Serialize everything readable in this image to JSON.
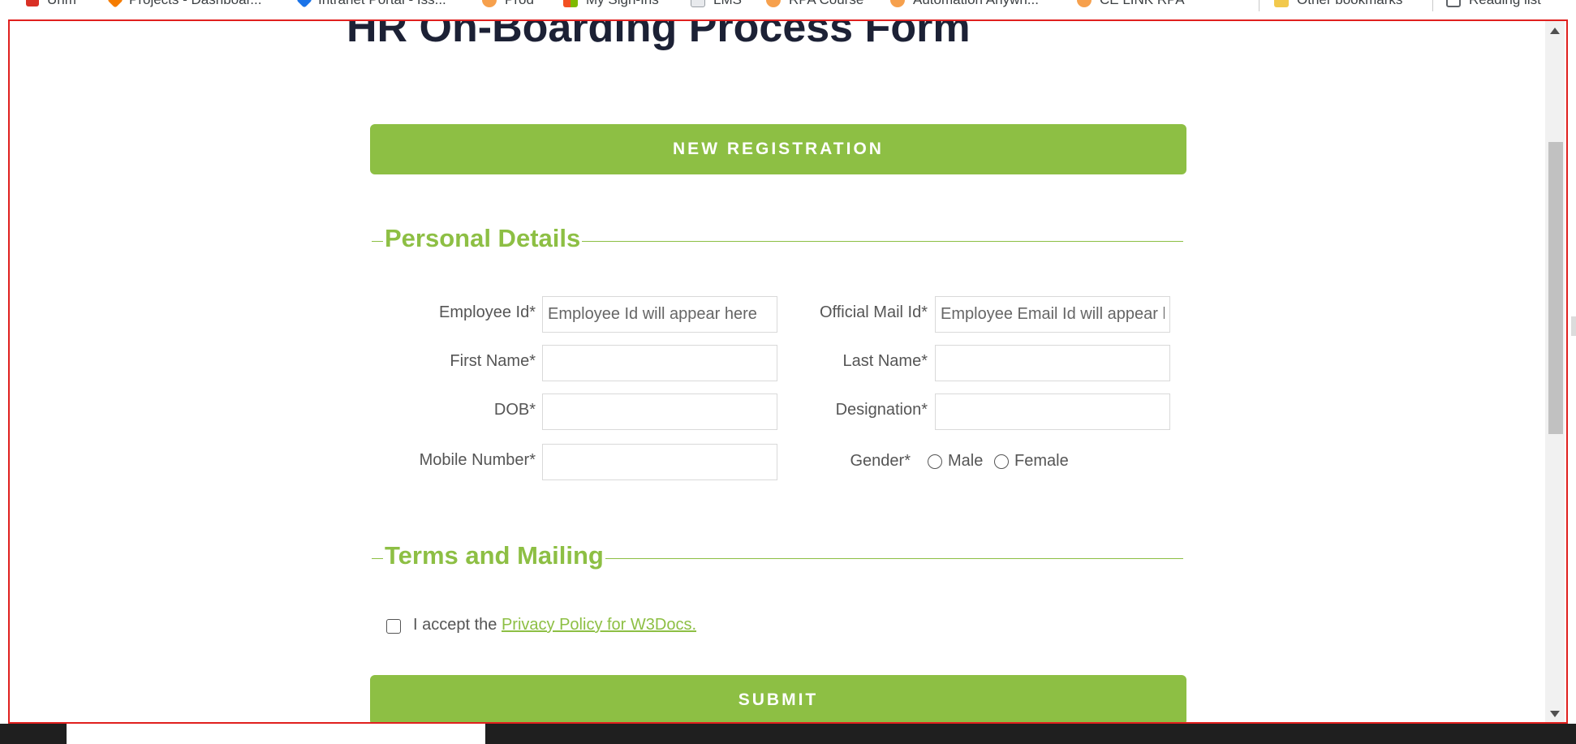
{
  "bookmarks": [
    {
      "label": "Unm",
      "color": "#d93025"
    },
    {
      "label": "Projects - Dashboar...",
      "color": "#f57c00"
    },
    {
      "label": "Intranet Portal - Iss...",
      "color": "#1a73e8"
    },
    {
      "label": "Prod",
      "color": "#f6a04d"
    },
    {
      "label": "My Sign-Ins",
      "color": "#00a4ef"
    },
    {
      "label": "LMS",
      "color": "#5f6368"
    },
    {
      "label": "RPA Course",
      "color": "#f6a04d"
    },
    {
      "label": "Automation Anywh...",
      "color": "#f6a04d"
    },
    {
      "label": "CE LINK RPA",
      "color": "#f6a04d"
    },
    {
      "label": "Other bookmarks",
      "color": "#f2c94c"
    },
    {
      "label": "Reading list",
      "color": "#5f6368"
    }
  ],
  "page": {
    "title": "HR On-Boarding Process Form",
    "new_registration_label": "NEW REGISTRATION",
    "submit_label": "SUBMIT"
  },
  "personal": {
    "legend": "Personal Details",
    "employee_id_label": "Employee Id*",
    "employee_id_placeholder": "Employee Id will appear here",
    "official_mail_label": "Official Mail Id*",
    "official_mail_placeholder": "Employee Email Id will appear here",
    "first_name_label": "First Name*",
    "last_name_label": "Last Name*",
    "dob_label": "DOB*",
    "designation_label": "Designation*",
    "mobile_label": "Mobile Number*",
    "gender_label": "Gender*",
    "gender_options": [
      "Male",
      "Female"
    ]
  },
  "terms": {
    "legend": "Terms and Mailing",
    "accept_text": "I accept the",
    "link_text": "Privacy Policy for W3Docs."
  },
  "colors": {
    "accent": "#8dbf44",
    "title": "#1c2135",
    "frame_border": "#e0201e"
  }
}
